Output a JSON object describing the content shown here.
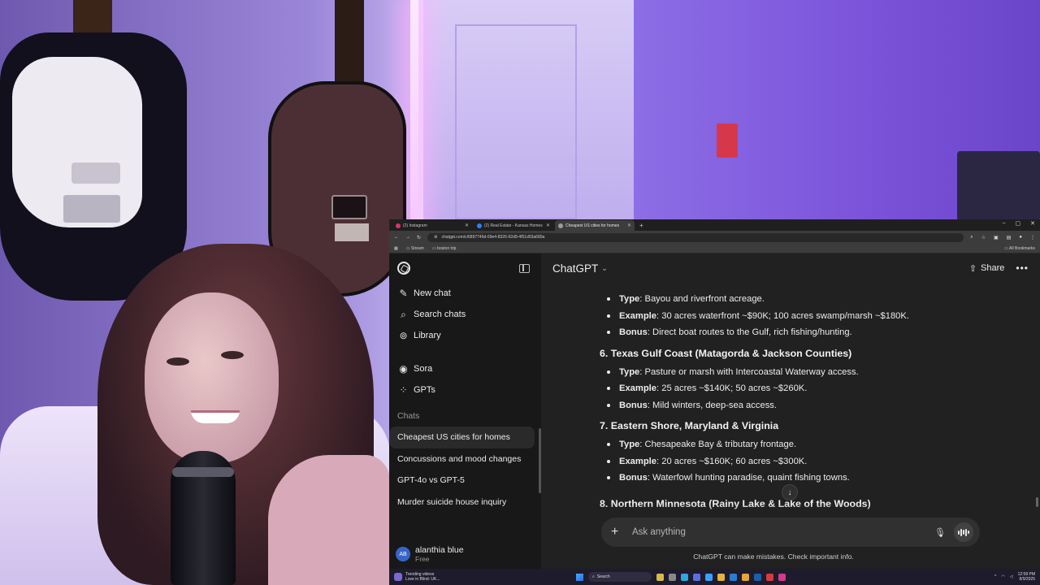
{
  "browser": {
    "tabs": [
      {
        "label": "(2) Instagram",
        "color": "#e1306c",
        "active": false
      },
      {
        "label": "(2) Real Estate - Kansas Homes",
        "color": "#2d7ff9",
        "active": false
      },
      {
        "label": "Cheapest US cities for homes",
        "color": "#9b9b9b",
        "active": true
      }
    ],
    "url": "chatgpt.com/c/6897746d-69e4-8326-92d9-4f51d93a680a",
    "bookmarks": [
      "Stream",
      "boston trip"
    ],
    "all_bookmarks": "All Bookmarks"
  },
  "sidebar": {
    "nav": [
      {
        "icon": "new-chat-icon",
        "glyph": "✎",
        "label": "New chat"
      },
      {
        "icon": "search-icon",
        "glyph": "⌕",
        "label": "Search chats"
      },
      {
        "icon": "library-icon",
        "glyph": "⊚",
        "label": "Library"
      },
      {
        "icon": "sora-icon",
        "glyph": "◉",
        "label": "Sora"
      },
      {
        "icon": "gpts-icon",
        "glyph": "⁘",
        "label": "GPTs"
      }
    ],
    "section_label": "Chats",
    "chats": [
      "Cheapest US cities for homes",
      "Concussions and mood changes",
      "GPT-4o vs GPT-5",
      "Murder suicide house inquiry"
    ],
    "user": {
      "initials": "AB",
      "name": "alanthia blue",
      "plan": "Free"
    }
  },
  "header": {
    "model": "ChatGPT",
    "share_label": "Share"
  },
  "content": {
    "top_bullets": [
      {
        "k": "Type",
        "v": ": Bayou and riverfront acreage."
      },
      {
        "k": "Example",
        "v": ": 30 acres waterfront ~$90K; 100 acres swamp/marsh ~$180K."
      },
      {
        "k": "Bonus",
        "v": ": Direct boat routes to the Gulf, rich fishing/hunting."
      }
    ],
    "sections": [
      {
        "title": "6. Texas Gulf Coast (Matagorda & Jackson Counties)",
        "bullets": [
          {
            "k": "Type",
            "v": ": Pasture or marsh with Intercoastal Waterway access."
          },
          {
            "k": "Example",
            "v": ": 25 acres ~$140K; 50 acres ~$260K."
          },
          {
            "k": "Bonus",
            "v": ": Mild winters, deep-sea access."
          }
        ]
      },
      {
        "title": "7. Eastern Shore, Maryland & Virginia",
        "bullets": [
          {
            "k": "Type",
            "v": ": Chesapeake Bay & tributary frontage."
          },
          {
            "k": "Example",
            "v": ": 20 acres ~$160K; 60 acres ~$300K."
          },
          {
            "k": "Bonus",
            "v": ": Waterfowl hunting paradise, quaint fishing towns."
          }
        ]
      }
    ],
    "cut_heading": "8. Northern Minnesota (Rainy Lake & Lake of the Woods)"
  },
  "composer": {
    "placeholder": "Ask anything",
    "disclaimer": "ChatGPT can make mistakes. Check important info."
  },
  "taskbar": {
    "news_title": "Trending videos",
    "news_sub": "Love in Blind: UK...",
    "search_label": "Search",
    "time": "12:58 PM",
    "date": "8/9/2025"
  }
}
